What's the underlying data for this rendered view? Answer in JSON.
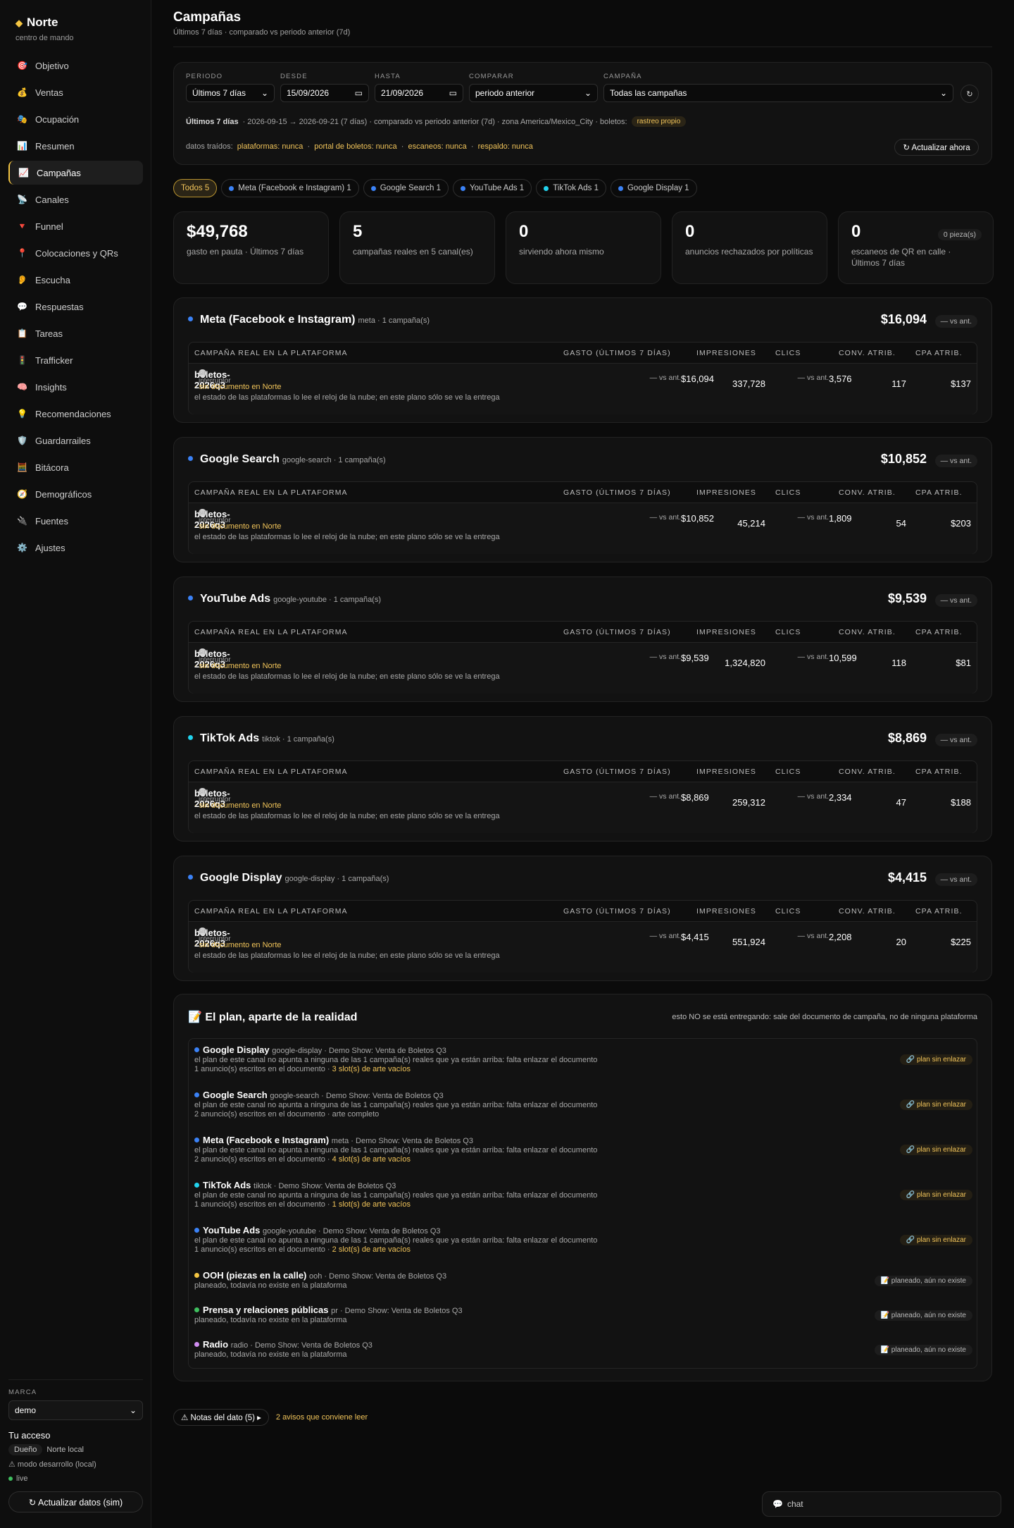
{
  "sidebar": {
    "brand": "Norte",
    "brand_sub": "centro de mando",
    "items": [
      {
        "icon": "🎯",
        "label": "Objetivo"
      },
      {
        "icon": "💰",
        "label": "Ventas"
      },
      {
        "icon": "🎭",
        "label": "Ocupación"
      },
      {
        "icon": "📊",
        "label": "Resumen"
      },
      {
        "icon": "📈",
        "label": "Campañas"
      },
      {
        "icon": "📡",
        "label": "Canales"
      },
      {
        "icon": "🔻",
        "label": "Funnel"
      },
      {
        "icon": "📍",
        "label": "Colocaciones y QRs"
      },
      {
        "icon": "👂",
        "label": "Escucha"
      },
      {
        "icon": "💬",
        "label": "Respuestas"
      },
      {
        "icon": "📋",
        "label": "Tareas"
      },
      {
        "icon": "🚦",
        "label": "Trafficker"
      },
      {
        "icon": "🧠",
        "label": "Insights"
      },
      {
        "icon": "💡",
        "label": "Recomendaciones"
      },
      {
        "icon": "🛡️",
        "label": "Guardarrailes"
      },
      {
        "icon": "🧮",
        "label": "Bitácora"
      },
      {
        "icon": "🧭",
        "label": "Demográficos"
      },
      {
        "icon": "🔌",
        "label": "Fuentes"
      },
      {
        "icon": "⚙️",
        "label": "Ajustes"
      }
    ],
    "marca_label": "MARCA",
    "marca_value": "demo",
    "access_title": "Tu acceso",
    "role": "Dueño",
    "scope": "Norte local",
    "dev_mode": "⚠ modo desarrollo (local)",
    "live": "live",
    "refresh": "↻ Actualizar datos (sim)"
  },
  "page": {
    "title": "Campañas",
    "subtitle": "Últimos 7 días · comparado vs periodo anterior (7d)"
  },
  "filters": {
    "periodo_label": "PERIODO",
    "periodo": "Últimos 7 días",
    "desde_label": "DESDE",
    "desde": "15/09/2026",
    "hasta_label": "HASTA",
    "hasta": "21/09/2026",
    "comparar_label": "COMPARAR",
    "comparar": "periodo anterior",
    "campana_label": "CAMPAÑA",
    "campana": "Todas las campañas",
    "refresh_icon": "↻",
    "summary_bold": "Últimos 7 días",
    "summary": "· 2026-09-15 → 2026-09-21 (7 días) · comparado vs periodo anterior (7d) · zona America/Mexico_City · boletos:",
    "boletos_badge": "rastreo propio",
    "datos_label": "datos traídos:",
    "datos": [
      "plataformas: nunca",
      "portal de boletos: nunca",
      "escaneos: nunca",
      "respaldo: nunca"
    ],
    "update_now": "↻ Actualizar ahora"
  },
  "tabs": [
    {
      "label": "Todos 5",
      "color": ""
    },
    {
      "label": "Meta (Facebook e Instagram) 1",
      "color": "#3b82f6"
    },
    {
      "label": "Google Search 1",
      "color": "#3b82f6"
    },
    {
      "label": "YouTube Ads 1",
      "color": "#3b82f6"
    },
    {
      "label": "TikTok Ads 1",
      "color": "#22d3ee"
    },
    {
      "label": "Google Display 1",
      "color": "#3b82f6"
    }
  ],
  "stats": [
    {
      "value": "$49,768",
      "label": "gasto en pauta · Últimos 7 días"
    },
    {
      "value": "5",
      "label": "campañas reales en 5 canal(es)"
    },
    {
      "value": "0",
      "label": "sirviendo ahora mismo"
    },
    {
      "value": "0",
      "label": "anuncios rechazados por políticas"
    },
    {
      "value": "0",
      "label": "escaneos de QR en calle · Últimos 7 días",
      "pill": "0 pieza(s)"
    }
  ],
  "table_headers": [
    "CAMPAÑA REAL EN LA PLATAFORMA",
    "GASTO (ÚLTIMOS 7 DÍAS)",
    "IMPRESIONES",
    "CLICS",
    "CONV. ATRIB.",
    "CPA ATRIB."
  ],
  "channels": [
    {
      "name": "Meta (Facebook e Instagram)",
      "sub": "meta · 1 campaña(s)",
      "color": "#3b82f6",
      "total": "$16,094",
      "vs": "— vs ant.",
      "campaign": "boletos-2026q3",
      "switch": "sin interruptor",
      "nodoc": "· sin documento en Norte",
      "note": "el estado de las plataformas lo lee el reloj de la nube; en este plano sólo se ve la entrega",
      "spend": "$16,094",
      "spend_vs": "— vs ant.",
      "impressions": "337,728",
      "clicks": "3,576",
      "clicks_vs": "— vs ant.",
      "conv": "117",
      "cpa": "$137"
    },
    {
      "name": "Google Search",
      "sub": "google-search · 1 campaña(s)",
      "color": "#3b82f6",
      "total": "$10,852",
      "vs": "— vs ant.",
      "campaign": "boletos-2026q3",
      "switch": "sin interruptor",
      "nodoc": "· sin documento en Norte",
      "note": "el estado de las plataformas lo lee el reloj de la nube; en este plano sólo se ve la entrega",
      "spend": "$10,852",
      "spend_vs": "— vs ant.",
      "impressions": "45,214",
      "clicks": "1,809",
      "clicks_vs": "— vs ant.",
      "conv": "54",
      "cpa": "$203"
    },
    {
      "name": "YouTube Ads",
      "sub": "google-youtube · 1 campaña(s)",
      "color": "#3b82f6",
      "total": "$9,539",
      "vs": "— vs ant.",
      "campaign": "boletos-2026q3",
      "switch": "sin interruptor",
      "nodoc": "· sin documento en Norte",
      "note": "el estado de las plataformas lo lee el reloj de la nube; en este plano sólo se ve la entrega",
      "spend": "$9,539",
      "spend_vs": "— vs ant.",
      "impressions": "1,324,820",
      "clicks": "10,599",
      "clicks_vs": "— vs ant.",
      "conv": "118",
      "cpa": "$81"
    },
    {
      "name": "TikTok Ads",
      "sub": "tiktok · 1 campaña(s)",
      "color": "#22d3ee",
      "total": "$8,869",
      "vs": "— vs ant.",
      "campaign": "boletos-2026q3",
      "switch": "sin interruptor",
      "nodoc": "· sin documento en Norte",
      "note": "el estado de las plataformas lo lee el reloj de la nube; en este plano sólo se ve la entrega",
      "spend": "$8,869",
      "spend_vs": "— vs ant.",
      "impressions": "259,312",
      "clicks": "2,334",
      "clicks_vs": "— vs ant.",
      "conv": "47",
      "cpa": "$188"
    },
    {
      "name": "Google Display",
      "sub": "google-display · 1 campaña(s)",
      "color": "#3b82f6",
      "total": "$4,415",
      "vs": "— vs ant.",
      "campaign": "boletos-2026q3",
      "switch": "sin interruptor",
      "nodoc": "· sin documento en Norte",
      "note": "el estado de las plataformas lo lee el reloj de la nube; en este plano sólo se ve la entrega",
      "spend": "$4,415",
      "spend_vs": "— vs ant.",
      "impressions": "551,924",
      "clicks": "2,208",
      "clicks_vs": "— vs ant.",
      "conv": "20",
      "cpa": "$225"
    }
  ],
  "plan": {
    "title": "📝 El plan, aparte de la realidad",
    "note": "esto NO se está entregando: sale del documento de campaña, no de ninguna plataforma",
    "items": [
      {
        "name": "Google Display",
        "sub": "google-display · Demo Show: Venta de Boletos Q3",
        "color": "#3b82f6",
        "line1": "el plan de este canal no apunta a ninguna de las 1 campaña(s) reales que ya están arriba: falta enlazar el documento",
        "line2": "1 anuncio(s) escritos en el documento ·",
        "line2_y": "3 slot(s) de arte vacíos",
        "badge": "🔗 plan sin enlazar"
      },
      {
        "name": "Google Search",
        "sub": "google-search · Demo Show: Venta de Boletos Q3",
        "color": "#3b82f6",
        "line1": "el plan de este canal no apunta a ninguna de las 1 campaña(s) reales que ya están arriba: falta enlazar el documento",
        "line2": "2 anuncio(s) escritos en el documento · arte completo",
        "line2_y": "",
        "badge": "🔗 plan sin enlazar"
      },
      {
        "name": "Meta (Facebook e Instagram)",
        "sub": "meta · Demo Show: Venta de Boletos Q3",
        "color": "#3b82f6",
        "line1": "el plan de este canal no apunta a ninguna de las 1 campaña(s) reales que ya están arriba: falta enlazar el documento",
        "line2": "2 anuncio(s) escritos en el documento ·",
        "line2_y": "4 slot(s) de arte vacíos",
        "badge": "🔗 plan sin enlazar"
      },
      {
        "name": "TikTok Ads",
        "sub": "tiktok · Demo Show: Venta de Boletos Q3",
        "color": "#22d3ee",
        "line1": "el plan de este canal no apunta a ninguna de las 1 campaña(s) reales que ya están arriba: falta enlazar el documento",
        "line2": "1 anuncio(s) escritos en el documento ·",
        "line2_y": "1 slot(s) de arte vacíos",
        "badge": "🔗 plan sin enlazar"
      },
      {
        "name": "YouTube Ads",
        "sub": "google-youtube · Demo Show: Venta de Boletos Q3",
        "color": "#3b82f6",
        "line1": "el plan de este canal no apunta a ninguna de las 1 campaña(s) reales que ya están arriba: falta enlazar el documento",
        "line2": "1 anuncio(s) escritos en el documento ·",
        "line2_y": "2 slot(s) de arte vacíos",
        "badge": "🔗 plan sin enlazar"
      },
      {
        "name": "OOH (piezas en la calle)",
        "sub": "ooh · Demo Show: Venta de Boletos Q3",
        "color": "#f4c542",
        "line1": "planeado, todavía no existe en la plataforma",
        "badge": "📝 planeado, aún no existe"
      },
      {
        "name": "Prensa y relaciones públicas",
        "sub": "pr · Demo Show: Venta de Boletos Q3",
        "color": "#3fbf5f",
        "line1": "planeado, todavía no existe en la plataforma",
        "badge": "📝 planeado, aún no existe"
      },
      {
        "name": "Radio",
        "sub": "radio · Demo Show: Venta de Boletos Q3",
        "color": "#d08cf0",
        "line1": "planeado, todavía no existe en la plataforma",
        "badge": "📝 planeado, aún no existe"
      }
    ]
  },
  "footer": {
    "notes": "⚠ Notas del dato (5) ▸",
    "warnings": "2 avisos que conviene leer"
  },
  "chat": {
    "icon": "💬",
    "label": "chat"
  }
}
